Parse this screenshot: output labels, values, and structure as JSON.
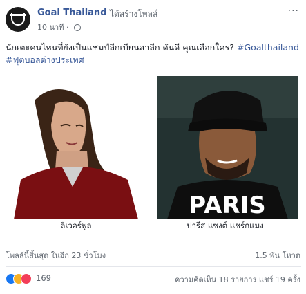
{
  "header": {
    "page_name": "Goal Thailand",
    "action_text": "ได้สร้างโพลล์",
    "time": "10 นาที",
    "more_label": "···"
  },
  "caption": {
    "text": "นักเตะคนไหนที่ยังเป็นแชมป์ลีกเบียนสาลีก ดันดี คุณเลือกใคร?",
    "hashtag1": "#Goalthailand",
    "hashtag2": "#ฟุตบอลต่างประเทศ"
  },
  "poll": {
    "option1": "ลิเวอร์พูล",
    "option2": "ปารีส แซงต์ แชร์กแมง",
    "sign_text": "PARIS"
  },
  "poll_info": {
    "ends": "โพลล์นี้สิ้นสุด ในอีก 23 ชั่วโมง",
    "votes": "1.5 พัน โหวต"
  },
  "footer": {
    "reaction_count": "169",
    "stats": "ความคิดเห็น 18 รายการ แชร์ 19 ครั้ง"
  },
  "colors": {
    "link": "#385898",
    "like": "#1877f2",
    "haha": "#f7b125",
    "love": "#f33e58"
  },
  "icons": [
    "avatar-logo-icon",
    "globe-icon",
    "more-icon",
    "like-reaction-icon",
    "haha-reaction-icon",
    "love-reaction-icon"
  ]
}
